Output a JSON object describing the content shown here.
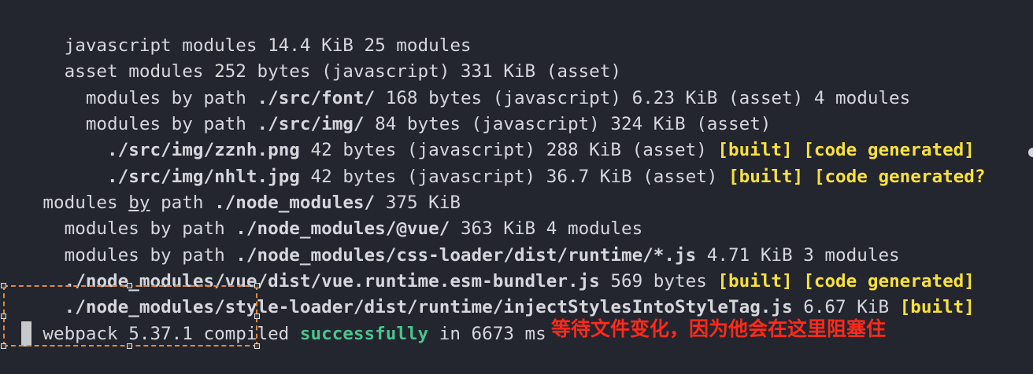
{
  "terminal": {
    "lines": [
      {
        "t1": "  javascript modules 14.4 KiB 25 modules"
      },
      {
        "t1": "  asset modules 252 bytes (javascript) 331 KiB (asset)"
      },
      {
        "t1": "    modules by path ",
        "path": "./src/font/",
        "t2": " 168 bytes (javascript) 6.23 KiB (asset) 4 modules"
      },
      {
        "t1": "    modules by path ",
        "path": "./src/img/",
        "t2": " 84 bytes (javascript) 324 KiB (asset)"
      },
      {
        "t1": "      ",
        "path": "./src/img/zznh.png",
        "t2": " 42 bytes (javascript) 288 KiB (asset) ",
        "tag1": "[built]",
        "sp": " ",
        "tag2": "[code generated]"
      },
      {
        "t1": "      ",
        "path": "./src/img/nhlt.jpg",
        "t2": " 42 bytes (javascript) 36.7 KiB (asset) ",
        "tag1": "[built]",
        "sp": " ",
        "tag2": "[code generated?"
      },
      {
        "t1": "modules ",
        "by": "by",
        "t2": " path ",
        "path": "./node_modules/",
        "t3": " 375 KiB"
      },
      {
        "t1": "  modules by path ",
        "path": "./node_modules/@vue/",
        "t2": " 363 KiB 4 modules"
      },
      {
        "t1": "  modules by path ",
        "path": "./node_modules/css-loader/dist/runtime/*.js",
        "t2": " 4.71 KiB 3 modules"
      },
      {
        "t1": "  ",
        "path": "./node_modules/vue/dist/vue.runtime.esm-bundler.js",
        "t2": " 569 bytes ",
        "tag1": "[built]",
        "sp": " ",
        "tag2": "[code generated]"
      },
      {
        "t1": "  ",
        "path": "./node_modules/style-loader/dist/runtime/injectStylesIntoStyleTag.js",
        "t2": " 6.67 KiB ",
        "tag1": "[built]"
      },
      {
        "t1": "webpack 5.37.1 compiled ",
        "ok": "successfully",
        "t2": " in 6673 ms"
      }
    ]
  },
  "annotation": "等待文件变化，因为他会在这里阻塞住",
  "colors": {
    "background": "#23252f",
    "text": "#d6d7dc",
    "status_yellow": "#f7e13e",
    "success_green": "#4cc38a",
    "annotation_red": "#ff2a1a",
    "selection_orange": "#e08a3a"
  }
}
